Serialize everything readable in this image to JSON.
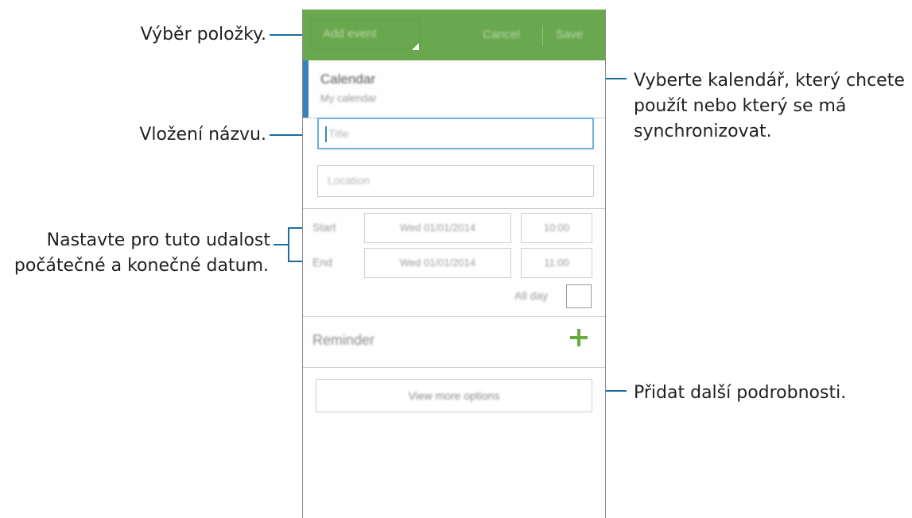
{
  "annotations": {
    "select_item": "Výběr položky.",
    "enter_title": "Vložení názvu.",
    "set_dates_line1": "Nastavte pro tuto udalost",
    "set_dates_line2": "počátečné a konečné datum.",
    "choose_calendar_line1": "Vyberte kalendář, který chcete",
    "choose_calendar_line2": "použít nebo který se má",
    "choose_calendar_line3": "synchronizovat.",
    "add_details": "Přidat další podrobnosti."
  },
  "action_bar": {
    "spinner_label": "Add event",
    "cancel_label": "Cancel",
    "save_label": "Save"
  },
  "calendar": {
    "title": "Calendar",
    "subtitle": "My calendar"
  },
  "fields": {
    "title_placeholder": "Title",
    "location_placeholder": "Location"
  },
  "schedule": {
    "start_label": "Start",
    "start_date": "Wed 01/01/2014",
    "start_time": "10:00",
    "end_label": "End",
    "end_date": "Wed 01/01/2014",
    "end_time": "11:00",
    "all_day_label": "All day",
    "all_day_checked": false
  },
  "reminder": {
    "label": "Reminder"
  },
  "more_options": {
    "label": "View more options"
  },
  "colors": {
    "action_bar": "#6aa84f",
    "calendar_accent": "#3583bd",
    "focus_border": "#6ab2e0",
    "plus_icon": "#6aab3f",
    "callout_line": "#1d6e9c"
  }
}
